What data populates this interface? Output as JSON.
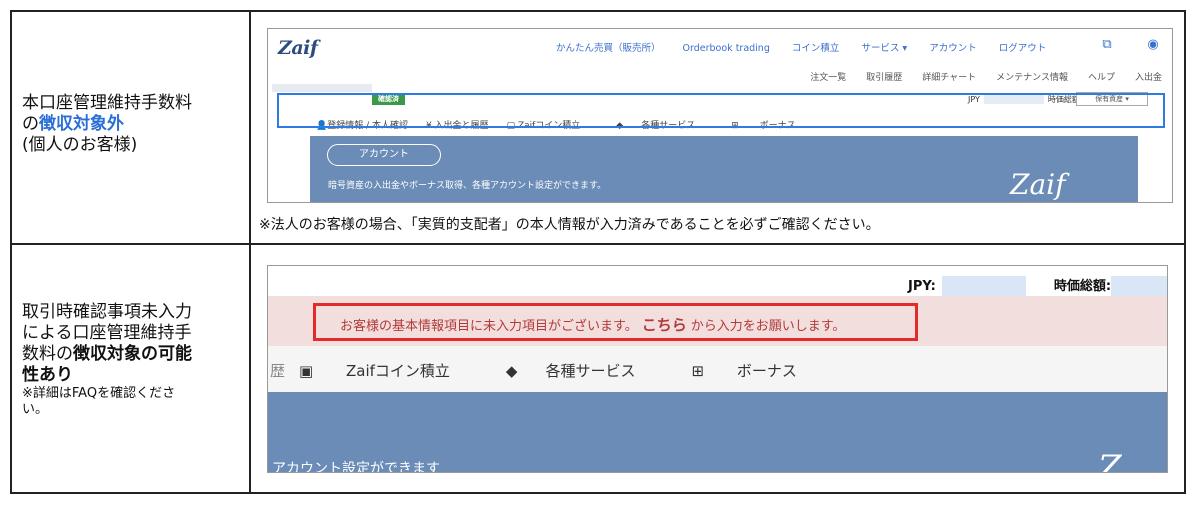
{
  "row1": {
    "line1": "本口座管理維持手数料",
    "line2_prefix": "の",
    "line2_highlight": "徴収対象外",
    "line3": "(個人のお客様)"
  },
  "row2": {
    "line1": "取引時確認事項未入力",
    "line2": "による口座管理維持手",
    "line3_prefix": "数料の",
    "line3_bold": "徴収対象の可能",
    "line4_bold": "性あり",
    "note1": "※詳細はFAQを確認くださ",
    "note2": "い。"
  },
  "shot1": {
    "logo": "Zaif",
    "topnav": [
      "かんたん売買（販売所）",
      "Orderbook trading",
      "コイン積立",
      "サービス ▾",
      "アカウント",
      "ログアウト"
    ],
    "subnav": [
      "注文一覧",
      "取引履歴",
      "詳細チャート",
      "メンテナンス情報",
      "ヘルプ",
      "入出金"
    ],
    "badge": "確認済",
    "jpy_label": "JPY",
    "total_label": "時価総額",
    "select_label": "保有資産 ▾",
    "menu": [
      "👤登録情報 / 本人確認",
      "¥ 入出金と履歴",
      "Zaifコイン積立",
      "各種サービス",
      "ボーナス"
    ],
    "account_pill": "アカウント",
    "banner_text": "暗号資産の入出金やボーナス取得、各種アカウント設定ができます。",
    "banner_logo": "Zaif"
  },
  "note": "※法人のお客様の場合、「実質的支配者」の本人情報が入力済みであることを必ずご確認ください。",
  "shot2": {
    "jpy_label": "JPY:",
    "total_label": "時価総額:",
    "alert_pre": "お客様の基本情報項目に未入力項目がございます。",
    "alert_link": "こちら",
    "alert_post": "から入力をお願いします。",
    "menu": [
      "歴",
      "Zaifコイン積立",
      "各種サービス",
      "ボーナス"
    ],
    "banner_text": "アカウント設定ができます",
    "banner_logo": "Z"
  }
}
